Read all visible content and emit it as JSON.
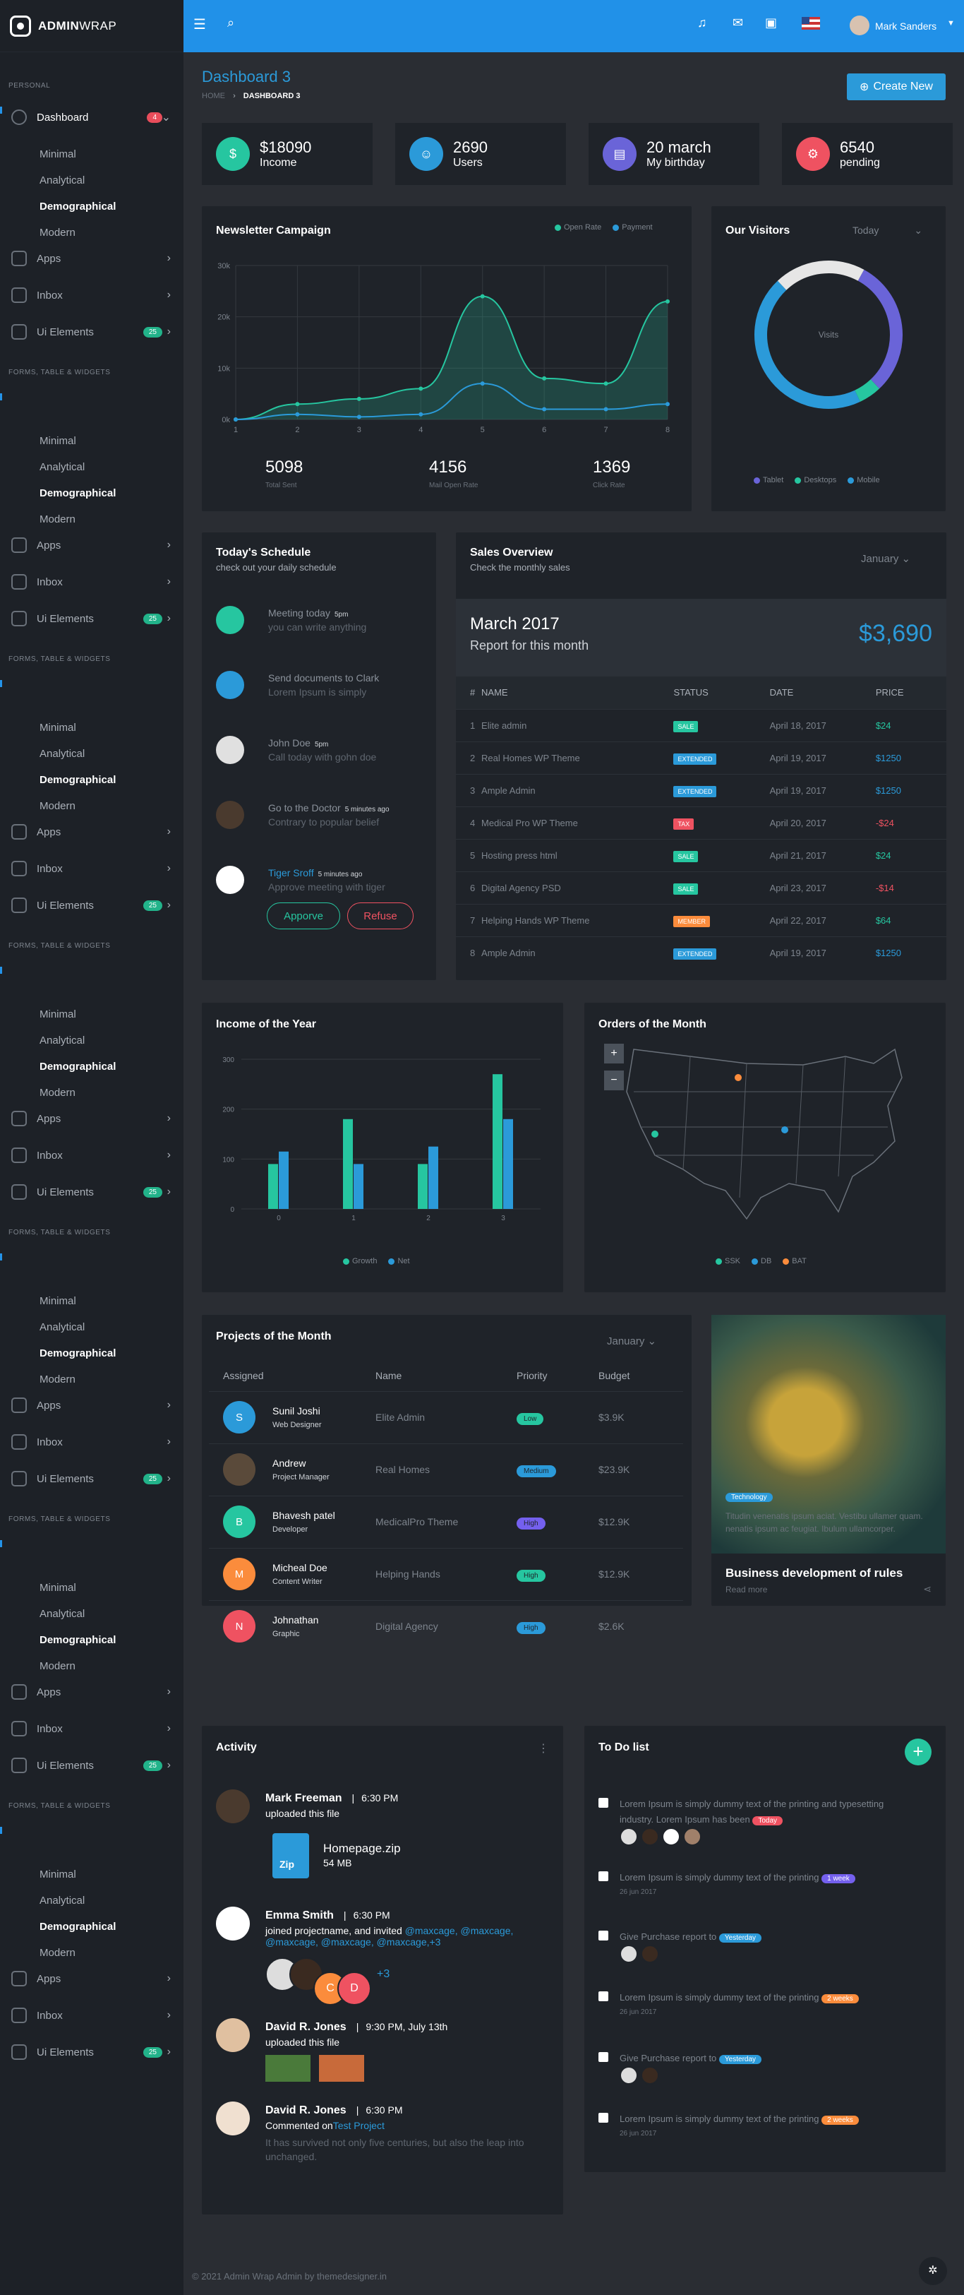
{
  "brand": {
    "bold": "ADMIN",
    "light": "WRAP"
  },
  "sidebar": {
    "personal": "PERSONAL",
    "forms": "FORMS, TABLE & WIDGETS",
    "dashboard": "Dashboard",
    "dashboard_badge": "4",
    "subs": [
      "Minimal",
      "Analytical",
      "Demographical",
      "Modern"
    ],
    "apps": "Apps",
    "inbox": "Inbox",
    "ui": "Ui Elements",
    "ui_badge": "25"
  },
  "topbar": {
    "user": "Mark Sanders"
  },
  "page": {
    "title": "Dashboard 3",
    "crumb_home": "HOME",
    "crumb_current": "DASHBOARD 3",
    "create": "Create New"
  },
  "stats": [
    {
      "value": "$18090",
      "label": "Income",
      "color": "#26c6a0"
    },
    {
      "value": "2690",
      "label": "Users",
      "color": "#2b9ad9"
    },
    {
      "value": "20 march",
      "label": "My birthday",
      "color": "#6a64d8"
    },
    {
      "value": "6540",
      "label": "pending",
      "color": "#ef5261"
    }
  ],
  "newsletter": {
    "title": "Newsletter Campaign",
    "legend": [
      "Open Rate",
      "Payment"
    ],
    "totals": [
      {
        "v": "5098",
        "l": "Total Sent"
      },
      {
        "v": "4156",
        "l": "Mail Open Rate"
      },
      {
        "v": "1369",
        "l": "Click Rate"
      }
    ]
  },
  "chart_data": [
    {
      "type": "area",
      "title": "Newsletter Campaign",
      "x": [
        1,
        2,
        3,
        4,
        5,
        6,
        7,
        8
      ],
      "yticks": [
        "0k",
        "10k",
        "20k",
        "30k"
      ],
      "ylim": [
        0,
        30
      ],
      "series": [
        {
          "name": "Open Rate",
          "values": [
            0,
            3,
            4,
            6,
            24,
            8,
            7,
            23
          ]
        },
        {
          "name": "Payment",
          "values": [
            0,
            1,
            0.5,
            1,
            7,
            2,
            2,
            3
          ]
        }
      ]
    },
    {
      "type": "pie",
      "title": "Our Visitors",
      "series": [
        {
          "name": "Tablet",
          "value": 30
        },
        {
          "name": "Desktops",
          "value": 5
        },
        {
          "name": "Mobile",
          "value": 45
        },
        {
          "name": "Other",
          "value": 20
        }
      ]
    },
    {
      "type": "bar",
      "title": "Income of the Year",
      "categories": [
        "0",
        "1",
        "2",
        "3"
      ],
      "yticks": [
        "0",
        "100",
        "200",
        "300"
      ],
      "ylim": [
        0,
        300
      ],
      "series": [
        {
          "name": "Growth",
          "values": [
            90,
            180,
            90,
            270
          ]
        },
        {
          "name": "Net",
          "values": [
            115,
            90,
            125,
            180
          ]
        }
      ]
    }
  ],
  "visitors": {
    "title": "Our Visitors",
    "period": "Today",
    "center": "Visits",
    "legend": [
      "Tablet",
      "Desktops",
      "Mobile"
    ]
  },
  "schedule": {
    "title": "Today's Schedule",
    "sub": "check out your daily schedule",
    "items": [
      {
        "t": "Meeting today",
        "time": "5pm",
        "d": "you can write anything"
      },
      {
        "t": "Send documents to Clark",
        "time": "",
        "d": "Lorem Ipsum is simply"
      },
      {
        "t": "John Doe",
        "time": "5pm",
        "d": "Call today with gohn doe"
      },
      {
        "t": "Go to the Doctor",
        "time": "5 minutes ago",
        "d": "Contrary to popular belief"
      },
      {
        "t": "Tiger Sroff",
        "time": "5 minutes ago",
        "d": "Approve meeting with tiger"
      }
    ],
    "approve": "Apporve",
    "refuse": "Refuse"
  },
  "sales": {
    "title": "Sales Overview",
    "sub": "Check the monthly sales",
    "month": "January",
    "report_title": "March 2017",
    "report_sub": "Report for this month",
    "amount": "$3,690",
    "headers": [
      "#",
      "NAME",
      "STATUS",
      "DATE",
      "PRICE"
    ],
    "rows": [
      [
        "1",
        "Elite admin",
        "SALE",
        "April 18, 2017",
        "$24"
      ],
      [
        "2",
        "Real Homes WP Theme",
        "EXTENDED",
        "April 19, 2017",
        "$1250"
      ],
      [
        "3",
        "Ample Admin",
        "EXTENDED",
        "April 19, 2017",
        "$1250"
      ],
      [
        "4",
        "Medical Pro WP Theme",
        "TAX",
        "April 20, 2017",
        "-$24"
      ],
      [
        "5",
        "Hosting press html",
        "SALE",
        "April 21, 2017",
        "$24"
      ],
      [
        "6",
        "Digital Agency PSD",
        "SALE",
        "April 23, 2017",
        "-$14"
      ],
      [
        "7",
        "Helping Hands WP Theme",
        "member",
        "April 22, 2017",
        "$64"
      ],
      [
        "8",
        "Ample Admin",
        "EXTENDED",
        "April 19, 2017",
        "$1250"
      ]
    ]
  },
  "income": {
    "title": "Income of the Year",
    "legend": [
      "Growth",
      "Net"
    ]
  },
  "orders": {
    "title": "Orders of the Month",
    "legend": [
      "SSK",
      "DB",
      "BAT"
    ]
  },
  "projects": {
    "title": "Projects of the Month",
    "month": "January",
    "headers": [
      "Assigned",
      "Name",
      "Priority",
      "Budget"
    ],
    "rows": [
      {
        "initial": "S",
        "color": "#2b9ad9",
        "name": "Sunil Joshi",
        "role": "Web Designer",
        "proj": "Elite Admin",
        "prio": "Low",
        "pcolor": "#26c6a0",
        "budget": "$3.9K"
      },
      {
        "initial": "",
        "color": "#5a4a3a",
        "name": "Andrew",
        "role": "Project Manager",
        "proj": "Real Homes",
        "prio": "Medium",
        "pcolor": "#2b9ad9",
        "budget": "$23.9K"
      },
      {
        "initial": "B",
        "color": "#26c6a0",
        "name": "Bhavesh patel",
        "role": "Developer",
        "proj": "MedicalPro Theme",
        "prio": "High",
        "pcolor": "#7460ee",
        "budget": "$12.9K"
      },
      {
        "initial": "M",
        "color": "#fb8c3c",
        "name": "Micheal Doe",
        "role": "Content Writer",
        "proj": "Helping Hands",
        "prio": "High",
        "pcolor": "#26c6a0",
        "budget": "$12.9K"
      },
      {
        "initial": "N",
        "color": "#ef5261",
        "name": "Johnathan",
        "role": "Graphic",
        "proj": "Digital Agency",
        "prio": "High",
        "pcolor": "#2b9ad9",
        "budget": "$2.6K"
      }
    ]
  },
  "blog": {
    "title": "Business development of rules",
    "tag": "Technology",
    "text": "Titudin venenatis ipsum aciat. Vestibu ullamer quam. nenatis ipsum ac feugiat. Ibulum ullamcorper.",
    "read": "Read more"
  },
  "activity": {
    "title": "Activity",
    "items": [
      {
        "name": "Mark Freeman",
        "time": "6:30 PM",
        "text": "uploaded this file",
        "file": "Homepage.zip",
        "size": "54 MB",
        "ftype": "Zip"
      },
      {
        "name": "Emma Smith",
        "time": "6:30 PM",
        "text": "joined projectname, and invited",
        "links": "@maxcage, @maxcage, @maxcage, @maxcage, @maxcage,+3",
        "more": "+3"
      },
      {
        "name": "David R. Jones",
        "time": "9:30 PM, July 13th",
        "text": "uploaded this file"
      },
      {
        "name": "David R. Jones",
        "time": "6:30 PM",
        "text": "Commented on",
        "link": "Test Project",
        "desc": "It has survived not only five centuries, but also the leap into unchanged."
      }
    ]
  },
  "todo": {
    "title": "To Do list",
    "items": [
      {
        "t": "Lorem Ipsum is simply dummy text of the printing and typesetting industry. Lorem Ipsum has been",
        "tag": "Today",
        "tc": "#ef5261",
        "date": ""
      },
      {
        "t": "Lorem Ipsum is simply dummy text of the printing",
        "tag": "1 week",
        "tc": "#7460ee",
        "date": "26 jun 2017"
      },
      {
        "t": "Give Purchase report to",
        "tag": "Yesterday",
        "tc": "#2b9ad9",
        "date": ""
      },
      {
        "t": "Lorem Ipsum is simply dummy text of the printing",
        "tag": "2 weeks",
        "tc": "#fb8c3c",
        "date": "26 jun 2017"
      },
      {
        "t": "Give Purchase report to",
        "tag": "Yesterday",
        "tc": "#2b9ad9",
        "date": ""
      },
      {
        "t": "Lorem Ipsum is simply dummy text of the printing",
        "tag": "2 weeks",
        "tc": "#fb8c3c",
        "date": "26 jun 2017"
      }
    ]
  },
  "footer": "© 2021 Admin Wrap Admin by themedesigner.in"
}
